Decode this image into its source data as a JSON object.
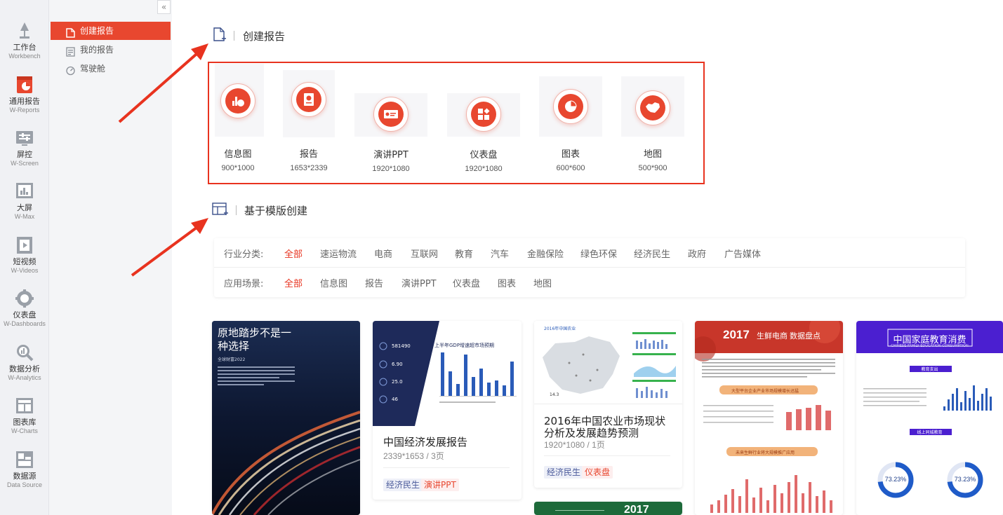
{
  "rail": [
    {
      "cn": "工作台",
      "en": "Workbench",
      "icon": "lamp-icon"
    },
    {
      "cn": "通用报告",
      "en": "W-Reports",
      "icon": "report-calendar-icon"
    },
    {
      "cn": "屏控",
      "en": "W-Screen",
      "icon": "screen-control-icon"
    },
    {
      "cn": "大屏",
      "en": "W-Max",
      "icon": "bigscreen-icon"
    },
    {
      "cn": "短视频",
      "en": "W-Videos",
      "icon": "video-icon"
    },
    {
      "cn": "仪表盘",
      "en": "W-Dashboards",
      "icon": "dashboard-gear-icon"
    },
    {
      "cn": "数据分析",
      "en": "W-Analytics",
      "icon": "magnifier-chart-icon"
    },
    {
      "cn": "图表库",
      "en": "W-Charts",
      "icon": "chart-library-icon"
    },
    {
      "cn": "数据源",
      "en": "Data Source",
      "icon": "data-source-icon"
    }
  ],
  "collapse_glyph": "«",
  "submenu": [
    {
      "label": "创建报告",
      "active": true,
      "icon": "new-report-icon"
    },
    {
      "label": "我的报告",
      "active": false,
      "icon": "my-report-icon"
    },
    {
      "label": "驾驶舱",
      "active": false,
      "icon": "cockpit-gauge-icon"
    }
  ],
  "section_create": {
    "title": "创建报告"
  },
  "create_cards": [
    {
      "label": "信息图",
      "size": "900*1000"
    },
    {
      "label": "报告",
      "size": "1653*2339"
    },
    {
      "label": "演讲PPT",
      "size": "1920*1080"
    },
    {
      "label": "仪表盘",
      "size": "1920*1080"
    },
    {
      "label": "图表",
      "size": "600*600"
    },
    {
      "label": "地图",
      "size": "500*900"
    }
  ],
  "section_template": {
    "title": "基于模版创建"
  },
  "filters": {
    "industry_label": "行业分类:",
    "industry": [
      "全部",
      "速运物流",
      "电商",
      "互联网",
      "教育",
      "汽车",
      "金融保险",
      "绿色环保",
      "经济民生",
      "政府",
      "广告媒体"
    ],
    "scene_label": "应用场景:",
    "scene": [
      "全部",
      "信息图",
      "报告",
      "演讲PPT",
      "仪表盘",
      "图表",
      "地图"
    ]
  },
  "templates": {
    "t1": {
      "heading": "原地踏步不是一种选择",
      "sub": "全球财富2022"
    },
    "t2": {
      "title": "中国经济发展报告",
      "size": "2339*1653 / 3页",
      "tags": [
        "经济民生",
        "演讲PPT"
      ],
      "chart_heading": "上半年GDP增速超市场预期",
      "stats": [
        "581490",
        "6.90",
        "25.0",
        "46"
      ]
    },
    "t3": {
      "title": "2016年中国农业市场现状分析及发展趋势预测",
      "size": "1920*1080 / 1页",
      "tags": [
        "经济民生",
        "仪表盘"
      ],
      "header": "2016年中国农业",
      "number": "14.3"
    },
    "t4": {
      "year": "2017",
      "heading": "生鲜电商",
      "heading2": "数据盘点",
      "band1": "大型平台企业产业市场规模增长迅猛",
      "band2": "未来生鲜行业将大规模推广应用"
    },
    "t5": {
      "heading": "中国家庭教育消费",
      "sub": "CHINESE FAMILY EDUCATION CONSUMPTION",
      "band": "教育支出",
      "band2": "线上同城教育",
      "donut1": "73.23%",
      "donut2": "73.23%"
    },
    "t6": {
      "year": "2017"
    }
  },
  "colors": {
    "accent": "#e8472f",
    "box_red": "#e8331f",
    "navy": "#1e2a5a",
    "purple": "#4b1fd0",
    "green": "#1d6a3a",
    "bar_blue": "#2a5bb8"
  }
}
